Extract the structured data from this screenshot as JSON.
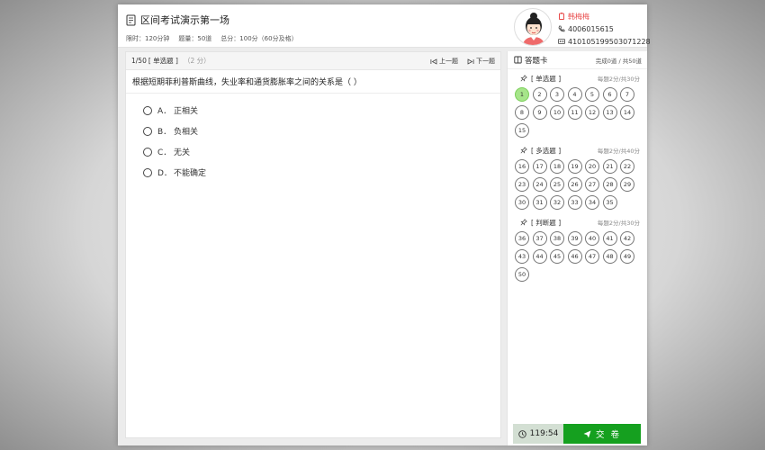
{
  "header": {
    "exam_title": "区间考试演示第一场",
    "time_limit": "限时：120分钟",
    "question_count": "题量：50道",
    "total_score": "总分：100分（60分及格）"
  },
  "user": {
    "name": "韩梅梅",
    "phone": "4006015615",
    "id_number": "410105199503071228"
  },
  "question": {
    "index": "1/50",
    "type": "[ 单选题 ]",
    "score": "（2 分）",
    "prev_label": "上一题",
    "next_label": "下一题",
    "stem": "根据短期菲利普斯曲线，失业率和通货膨胀率之间的关系是（ ）",
    "options": [
      {
        "letter": "A．",
        "text": "正相关"
      },
      {
        "letter": "B．",
        "text": "负相关"
      },
      {
        "letter": "C．",
        "text": "无关"
      },
      {
        "letter": "D．",
        "text": "不能确定"
      }
    ]
  },
  "answer_card": {
    "title": "答题卡",
    "progress": "完成0道 / 共50道",
    "sections": [
      {
        "name": "[ 单选题 ]",
        "rule": "每题2分/共30分",
        "numbers": [
          "1",
          "2",
          "3",
          "4",
          "5",
          "6",
          "7",
          "8",
          "9",
          "10",
          "11",
          "12",
          "13",
          "14",
          "15"
        ]
      },
      {
        "name": "[ 多选题 ]",
        "rule": "每题2分/共40分",
        "numbers": [
          "16",
          "17",
          "18",
          "19",
          "20",
          "21",
          "22",
          "23",
          "24",
          "25",
          "26",
          "27",
          "28",
          "29",
          "30",
          "31",
          "32",
          "33",
          "34",
          "35"
        ]
      },
      {
        "name": "[ 判断题 ]",
        "rule": "每题2分/共30分",
        "numbers": [
          "36",
          "37",
          "38",
          "39",
          "40",
          "41",
          "42",
          "43",
          "44",
          "45",
          "46",
          "47",
          "48",
          "49",
          "50"
        ]
      }
    ],
    "current": "1"
  },
  "footer": {
    "timer": "119:54",
    "submit_label": "交 卷"
  },
  "colors": {
    "accent_green": "#15a01f",
    "current_bubble": "#a6e58a",
    "user_name_red": "#e84a4a"
  }
}
